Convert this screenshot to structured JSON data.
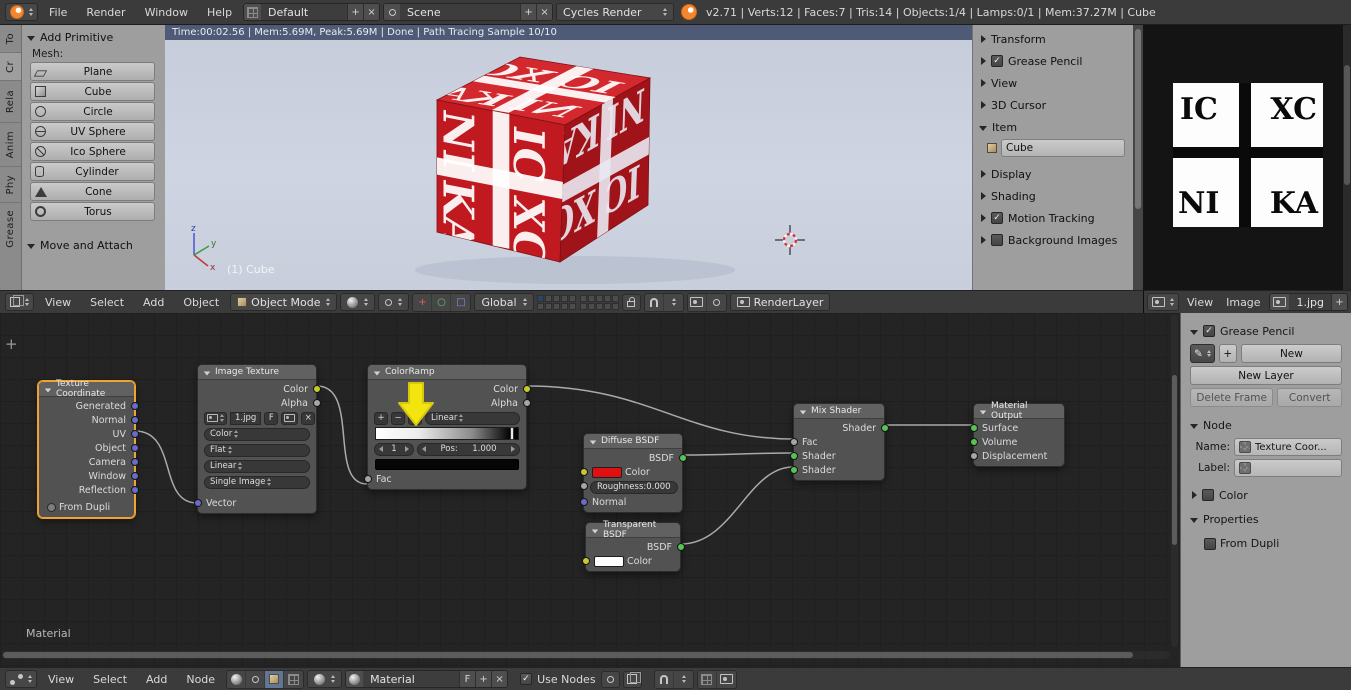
{
  "icons": {
    "plus": "+",
    "minus": "−",
    "close": "×",
    "check": "✓",
    "swap": "↔",
    "fake_user": "F",
    "pencil": "✎"
  },
  "colors": {
    "cube_red": "#c01a20",
    "diffuse_swatch": "#e01010",
    "transparent_swatch": "#ffffff",
    "selected_node_outline": "#efa430",
    "annotation_yellow": "#f2e50f",
    "render_status_bar": "#4e5a76"
  },
  "top_header": {
    "menus": [
      "File",
      "Render",
      "Window",
      "Help"
    ],
    "layout_value": "Default",
    "scene_value": "Scene",
    "engine_value": "Cycles Render",
    "stats": "v2.71 | Verts:12 | Faces:7 | Tris:14 | Objects:1/4 | Lamps:0/1 | Mem:37.27M | Cube"
  },
  "tool_shelf": {
    "tabs": [
      "To",
      "Cr",
      "Rela",
      "Anim",
      "Phy",
      "Grease"
    ],
    "add_primitive_title": "Add Primitive",
    "mesh_label": "Mesh:",
    "mesh_buttons": [
      "Plane",
      "Cube",
      "Circle",
      "UV Sphere",
      "Ico Sphere",
      "Cylinder",
      "Cone",
      "Torus"
    ],
    "move_attach_title": "Move and Attach"
  },
  "viewport": {
    "render_status": "Time:00:02.56 | Mem:5.69M, Peak:5.69M | Done | Path Tracing Sample 10/10",
    "active_object_label": "(1) Cube",
    "axis": {
      "x": "x",
      "y": "y",
      "z": "z"
    }
  },
  "viewport_header": {
    "menus": [
      "View",
      "Select",
      "Add",
      "Object"
    ],
    "mode_value": "Object Mode",
    "orientation_value": "Global",
    "render_layer_value": "RenderLayer"
  },
  "n_panel": {
    "panels": [
      {
        "label": "Transform"
      },
      {
        "label": "Grease Pencil"
      },
      {
        "label": "View"
      },
      {
        "label": "3D Cursor"
      },
      {
        "label": "Item"
      },
      {
        "label": "Display"
      },
      {
        "label": "Shading"
      },
      {
        "label": "Motion Tracking"
      },
      {
        "label": "Background Images"
      }
    ],
    "item_name_value": "Cube"
  },
  "image_editor": {
    "menus": [
      "View",
      "Image"
    ],
    "image_name": "1.jpg",
    "quadrants": [
      "IC",
      "XC",
      "NI",
      "KA"
    ]
  },
  "node_editor": {
    "tree_path": "Material",
    "nodes": {
      "texture_coordinate": {
        "title": "Texture Coordinate",
        "outputs": [
          "Generated",
          "Normal",
          "UV",
          "Object",
          "Camera",
          "Window",
          "Reflection"
        ],
        "from_dupli_label": "From Dupli"
      },
      "image_texture": {
        "title": "Image Texture",
        "outputs": [
          "Color",
          "Alpha"
        ],
        "image_name": "1.jpg",
        "color_space": "Color",
        "projection": "Flat",
        "interpolation": "Linear",
        "source": "Single Image",
        "input": "Vector"
      },
      "color_ramp": {
        "title": "ColorRamp",
        "outputs": [
          "Color",
          "Alpha"
        ],
        "interpolation": "Linear",
        "index_value": "1",
        "position_value": "Pos:",
        "position_number": "1.000",
        "input": "Fac"
      },
      "diffuse_bsdf": {
        "title": "Diffuse BSDF",
        "output": "BSDF",
        "color_label": "Color",
        "roughness_value": "Roughness:0.000",
        "normal_label": "Normal"
      },
      "transparent_bsdf": {
        "title": "Transparent BSDF",
        "output": "BSDF",
        "color_label": "Color"
      },
      "mix_shader": {
        "title": "Mix Shader",
        "output": "Shader",
        "inputs": [
          "Fac",
          "Shader",
          "Shader"
        ]
      },
      "material_output": {
        "title": "Material Output",
        "inputs": [
          "Surface",
          "Volume",
          "Displacement"
        ]
      }
    }
  },
  "node_sidebar": {
    "grease_pencil_title": "Grease Pencil",
    "new_button": "New",
    "new_layer_button": "New Layer",
    "delete_frame_button": "Delete Frame",
    "convert_button": "Convert",
    "node_title": "Node",
    "name_label": "Name:",
    "name_value": "Texture Coor...",
    "label_label": "Label:",
    "color_title": "Color",
    "properties_title": "Properties",
    "from_dupli_label": "From Dupli"
  },
  "node_header": {
    "menus": [
      "View",
      "Select",
      "Add",
      "Node"
    ],
    "material_value": "Material",
    "use_nodes_label": "Use Nodes"
  }
}
